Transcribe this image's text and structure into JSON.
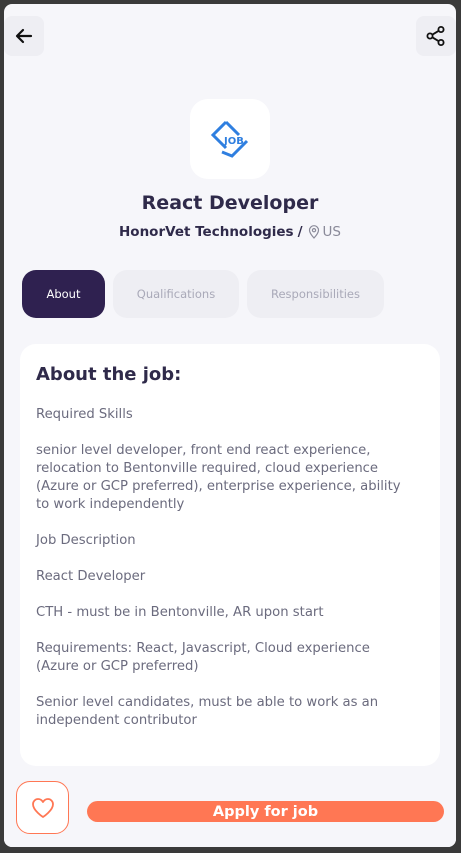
{
  "header": {
    "back_icon": "arrow-left-icon",
    "share_icon": "share-icon"
  },
  "job": {
    "logo_text": "JOB",
    "title": "React Developer",
    "company": "HonorVet Technologies",
    "separator": "/",
    "location": "US"
  },
  "tabs": [
    {
      "label": "About",
      "active": true
    },
    {
      "label": "Qualifications",
      "active": false
    },
    {
      "label": "Responsibilities",
      "active": false
    }
  ],
  "about": {
    "heading": "About the job:",
    "paragraphs": [
      "Required Skills",
      "senior level developer, front end react experience, relocation to Bentonville required, cloud experience (Azure or GCP preferred), enterprise experience, ability to work independently",
      "Job Description",
      "React Developer",
      "CTH - must be in Bentonville, AR upon start",
      "Requirements: React, Javascript, Cloud experience (Azure or GCP preferred)",
      "Senior level candidates, must be able to work as an independent contributor"
    ]
  },
  "footer": {
    "apply_label": "Apply for job",
    "favorite_icon": "heart-icon"
  },
  "colors": {
    "accent": "#ff7754",
    "primary_dark": "#2f2150",
    "logo_blue": "#2f7fe0"
  }
}
